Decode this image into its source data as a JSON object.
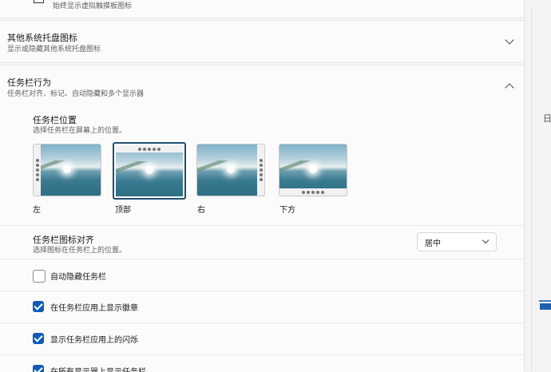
{
  "top_card": {
    "subtitle": "始终显示虚拟触摸板图标",
    "close_glyph": "✕"
  },
  "other_tray": {
    "title": "其他系统托盘图标",
    "subtitle": "显示或隐藏其他系统托盘图标"
  },
  "behavior": {
    "title": "任务栏行为",
    "subtitle": "任务栏对齐、标记、自动隐藏和多个显示器"
  },
  "position": {
    "title": "任务栏位置",
    "subtitle": "选择任务栏在屏幕上的位置。",
    "options": [
      {
        "label": "左",
        "selected": false
      },
      {
        "label": "顶部",
        "selected": true
      },
      {
        "label": "右",
        "selected": false
      },
      {
        "label": "下方",
        "selected": false
      }
    ]
  },
  "alignment": {
    "title": "任务栏图标对齐",
    "subtitle": "选择图标在任务栏上的位置。",
    "value": "居中"
  },
  "checkboxes": [
    {
      "label": "自动隐藏任务栏",
      "checked": false
    },
    {
      "label": "在任务栏应用上显示徽章",
      "checked": true
    },
    {
      "label": "显示任务栏应用上的闪烁",
      "checked": true
    },
    {
      "label": "在所有显示器上显示任务栏",
      "checked": true
    }
  ],
  "right_edge": {
    "glyph": "日"
  },
  "colors": {
    "accent": "#0f5cb5",
    "selected_border": "#1f4f73"
  }
}
